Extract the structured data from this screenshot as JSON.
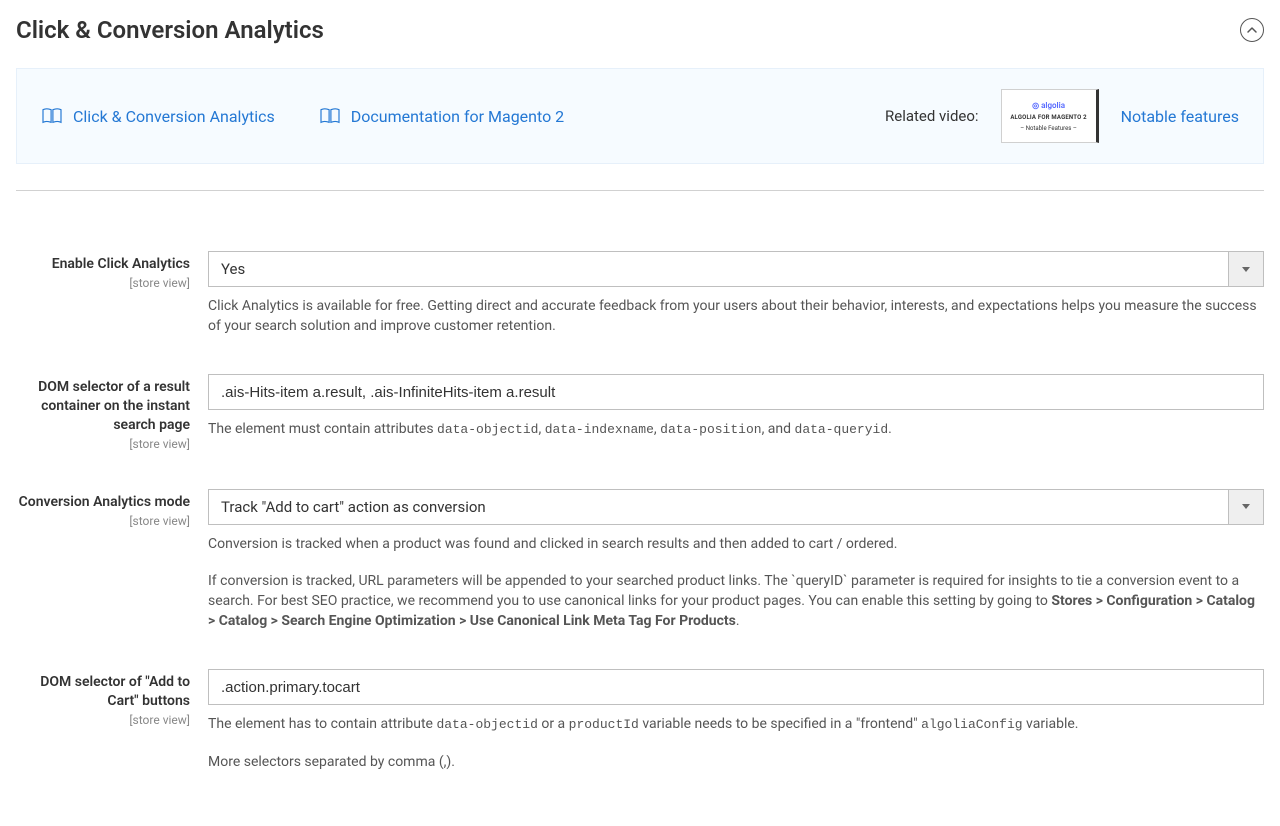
{
  "section_title": "Click & Conversion Analytics",
  "banner": {
    "doc1": "Click & Conversion Analytics",
    "doc2": "Documentation for Magento 2",
    "related_video_label": "Related video:",
    "thumb_logo": "◎ algolia",
    "thumb_line1": "ALGOLIA FOR MAGENTO 2",
    "thumb_line2": "– Notable Features –",
    "notable": "Notable features"
  },
  "scope": "[store view]",
  "fields": {
    "enableClick": {
      "label": "Enable Click Analytics",
      "value": "Yes",
      "help": "Click Analytics is available for free. Getting direct and accurate feedback from your users about their behavior, interests, and expectations helps you measure the success of your search solution and improve customer retention."
    },
    "domResult": {
      "label": "DOM selector of a result container on the instant search page",
      "value": ".ais-Hits-item a.result, .ais-InfiniteHits-item a.result",
      "help_pre": "The element must contain attributes ",
      "help_c1": "data-objectid",
      "help_c2": "data-indexname",
      "help_c3": "data-position",
      "help_mid": ", and ",
      "help_c4": "data-queryid",
      "help_post": "."
    },
    "convMode": {
      "label": "Conversion Analytics mode",
      "value": "Track \"Add to cart\" action as conversion",
      "help1": "Conversion is tracked when a product was found and clicked in search results and then added to cart / ordered.",
      "help2_pre": "If conversion is tracked, URL parameters will be appended to your searched product links. The `queryID` parameter is required for insights to tie a conversion event to a search. For best SEO practice, we recommend you to use canonical links for your product pages. You can enable this setting by going to ",
      "help2_strong": "Stores > Configuration > Catalog > Catalog > Search Engine Optimization > Use Canonical Link Meta Tag For Products",
      "help2_post": "."
    },
    "domCart": {
      "label": "DOM selector of \"Add to Cart\" buttons",
      "value": ".action.primary.tocart",
      "help1_pre": "The element has to contain attribute ",
      "help1_c1": "data-objectid",
      "help1_mid": " or a ",
      "help1_c2": "productId",
      "help1_mid2": " variable needs to be specified in a \"frontend\" ",
      "help1_c3": "algoliaConfig",
      "help1_post": " variable.",
      "help2": "More selectors separated by comma (,)."
    }
  }
}
